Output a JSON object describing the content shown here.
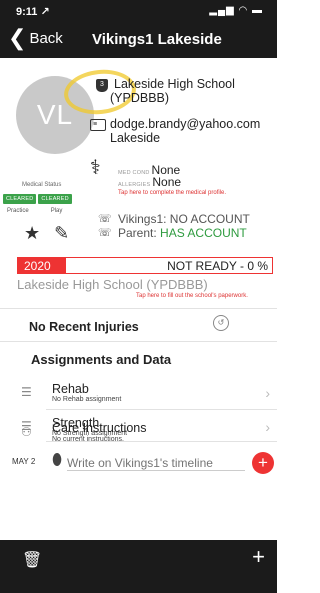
{
  "status_bar": {
    "time": "9:11 ↗",
    "icons": "▂▄▆ ◠ ▬"
  },
  "nav": {
    "back_label": "Back",
    "back_chevron": "❮",
    "title": "Vikings1 Lakeside"
  },
  "profile": {
    "initials": "VL",
    "school_icon_text": "3",
    "school": "Lakeside High School (YPDBBB)",
    "email_icon_text": "≡",
    "email": "dodge.brandy@yahoo.com",
    "city": "Lakeside",
    "medical_icon": "⚕",
    "med_cond_label": "MED COND",
    "med_cond": "None",
    "allergies_label": "ALLERGIES",
    "allergies": "None",
    "tap_medical": "Tap here to complete the medical profile.",
    "medical_status_label": "Medical Status",
    "badges": [
      "CLEARED",
      "CLEARED"
    ],
    "practice_label": "Practice",
    "play_label": "Play",
    "star_icon": "★",
    "edit_icon": "✎",
    "account_icon": "☏",
    "parent_icon": "☏",
    "account_line": "Vikings1: NO ACCOUNT",
    "parent_prefix": "Parent:",
    "parent_status": "HAS ACCOUNT"
  },
  "ready": {
    "year": "2020",
    "status": "NOT READY - 0 %"
  },
  "school_line": "Lakeside High School (YPDBBB)",
  "tap_paperwork": "Tap here to fill out the school's paperwork.",
  "injuries": {
    "label": "No Recent Injuries",
    "icon": "↺"
  },
  "assignments": {
    "heading": "Assignments and Data",
    "items": [
      {
        "icon": "☰",
        "title": "Rehab",
        "subtitle": "No Rehab assignment",
        "chevron": "›"
      },
      {
        "icon": "☰",
        "title": "Strength",
        "subtitle": "No Strength assignment",
        "chevron": "›"
      },
      {
        "icon": "⚇",
        "title": "Care Instructions",
        "subtitle": "No current instructions.",
        "chevron": ""
      }
    ]
  },
  "timeline": {
    "date": "MAY 2",
    "pin": "⬮",
    "placeholder": "Write on Vikings1's timeline",
    "add": "+"
  },
  "bottom_bar": {
    "trash": "🗑",
    "add": "+"
  }
}
